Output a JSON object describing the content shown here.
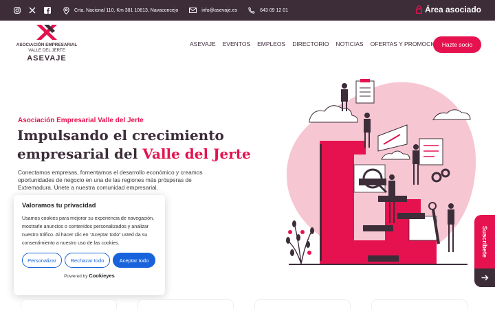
{
  "topbar": {
    "social": [
      "instagram-icon",
      "x-icon",
      "facebook-icon"
    ],
    "address": "Crta. Nacional 110, Km 381 10613, Navaconcejo",
    "email": "info@asevaje.es",
    "phone": "643 09 12 01",
    "area_label": "Área asociado"
  },
  "logo": {
    "line1": "ASOCIACIÓN EMPRESARIAL",
    "line2": "VALLE DEL JERTE",
    "line3": "ASEVAJE"
  },
  "nav": {
    "items": [
      "ASEVAJE",
      "EVENTOS",
      "EMPLEOS",
      "DIRECTORIO",
      "NOTICIAS",
      "OFERTAS Y PROMOCIONES"
    ],
    "cta": "Hazte socio"
  },
  "hero": {
    "subtitle": "Asociación Empresarial Valle del Jerte",
    "title_part1": "Impulsando el crecimiento empresarial del ",
    "title_accent": "Valle del Jerte",
    "text": "Conectamos empresas, fomentamos el desarrollo económico y creamos oportunidades de negocio en una de las regiones más prósperas de Extremadura. Únete a nuestra comunidad empresarial."
  },
  "cookie": {
    "title": "Valoramos tu privacidad",
    "text": "Usamos cookies para mejorar su experiencia de navegación, mostrarle anuncios o contenidos personalizados y analizar nuestro tráfico. Al hacer clic en “Aceptar todo” usted da su consentimiento a nuestro uso de las cookies.",
    "btn_customize": "Personalizar",
    "btn_reject": "Rechazar todo",
    "btn_accept": "Aceptar todo",
    "powered_by": "Powered by",
    "brand": "Cookieyes"
  },
  "side_tab": {
    "label": "Suscríbete"
  },
  "colors": {
    "brand_dark": "#3d2d39",
    "brand_red": "#e5124f",
    "cookie_blue": "#1863dc",
    "blob_pink": "#f7c6d3"
  }
}
